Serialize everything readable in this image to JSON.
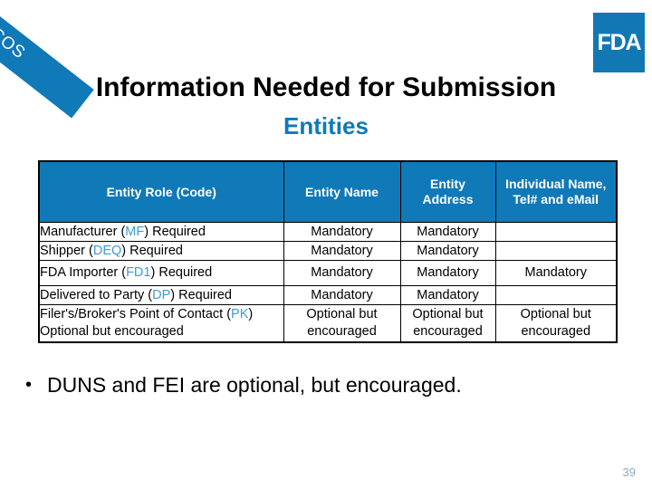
{
  "branding": {
    "corner_label": "COS",
    "logo_text": "FDA",
    "accent_color": "#1079b8",
    "code_color": "#3e9bd4"
  },
  "header": {
    "title": "Information Needed for Submission",
    "subtitle": "Entities"
  },
  "table": {
    "columns": [
      "Entity Role (Code)",
      "Entity Name",
      "Entity Address",
      "Individual Name, Tel# and eMail"
    ],
    "rows": [
      {
        "role_prefix": "Manufacturer (",
        "role_code": "MF",
        "role_suffix": ") Required",
        "role_extra": "",
        "entity_name": "Mandatory",
        "entity_address": "Mandatory",
        "individual": ""
      },
      {
        "role_prefix": "Shipper (",
        "role_code": "DEQ",
        "role_suffix": ") Required",
        "role_extra": "",
        "entity_name": "Mandatory",
        "entity_address": "Mandatory",
        "individual": ""
      },
      {
        "role_prefix": "FDA Importer (",
        "role_code": "FD1",
        "role_suffix": ") Required",
        "role_extra": "",
        "entity_name": "Mandatory",
        "entity_address": "Mandatory",
        "individual": "Mandatory"
      },
      {
        "role_prefix": "Delivered to Party (",
        "role_code": "DP",
        "role_suffix": ") Required",
        "role_extra": "",
        "entity_name": "Mandatory",
        "entity_address": "Mandatory",
        "individual": ""
      },
      {
        "role_prefix": "Filer's/Broker's Point of Contact (",
        "role_code": "PK",
        "role_suffix": ")",
        "role_extra": "Optional but encouraged",
        "entity_name": "Optional but encouraged",
        "entity_address": "Optional but encouraged",
        "individual": "Optional but encouraged"
      }
    ]
  },
  "bullets": [
    {
      "mark": "•",
      "text": "DUNS and FEI are optional, but encouraged."
    }
  ],
  "footer": {
    "page_number": "39"
  }
}
